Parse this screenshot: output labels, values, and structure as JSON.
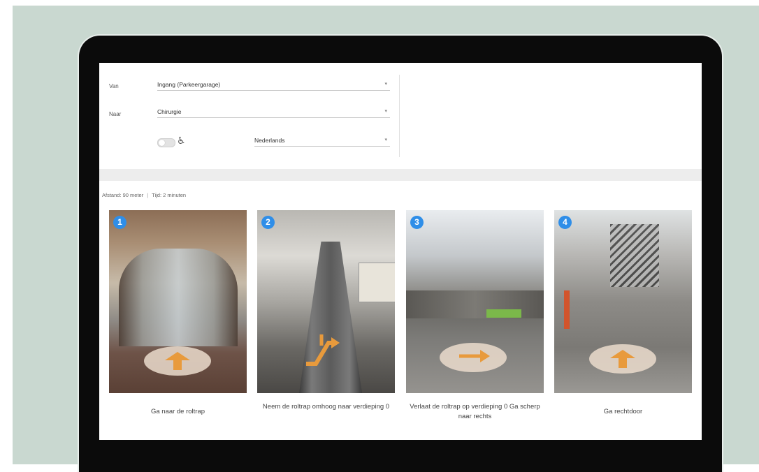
{
  "form": {
    "from_label": "Van",
    "from_value": "Ingang (Parkeergarage)",
    "to_label": "Naar",
    "to_value": "Chirurgie",
    "language_value": "Nederlands",
    "accessible_toggle_on": false
  },
  "route": {
    "distance": "Afstand: 90 meter",
    "time": "Tijd: 2 minuten"
  },
  "steps": [
    {
      "number": "1",
      "caption": "Ga naar de roltrap",
      "arrow": "up"
    },
    {
      "number": "2",
      "caption": "Neem de roltrap omhoog naar verdieping 0",
      "arrow": "escalator-up"
    },
    {
      "number": "3",
      "caption": "Verlaat de roltrap op verdieping 0 Ga scherp naar rechts",
      "arrow": "right"
    },
    {
      "number": "4",
      "caption": "Ga rechtdoor",
      "arrow": "up"
    }
  ],
  "colors": {
    "badge": "#2f8ee8",
    "arrow": "#e89a3c",
    "backdrop": "#c9d8d0"
  }
}
